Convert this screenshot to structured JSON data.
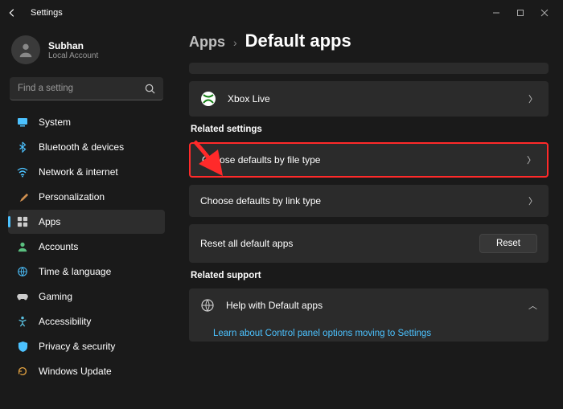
{
  "titlebar": {
    "title": "Settings"
  },
  "user": {
    "name": "Subhan",
    "account_type": "Local Account"
  },
  "search": {
    "placeholder": "Find a setting"
  },
  "sidebar": {
    "items": [
      {
        "label": "System"
      },
      {
        "label": "Bluetooth & devices"
      },
      {
        "label": "Network & internet"
      },
      {
        "label": "Personalization"
      },
      {
        "label": "Apps"
      },
      {
        "label": "Accounts"
      },
      {
        "label": "Time & language"
      },
      {
        "label": "Gaming"
      },
      {
        "label": "Accessibility"
      },
      {
        "label": "Privacy & security"
      },
      {
        "label": "Windows Update"
      }
    ]
  },
  "breadcrumb": {
    "parent": "Apps",
    "current": "Default apps"
  },
  "main": {
    "xbox": {
      "label": "Xbox Live"
    },
    "related_head": "Related settings",
    "file_type": {
      "label": "Choose defaults by file type"
    },
    "link_type": {
      "label": "Choose defaults by link type"
    },
    "reset_all": {
      "label": "Reset all default apps",
      "button": "Reset"
    },
    "support_head": "Related support",
    "help": {
      "label": "Help with Default apps"
    },
    "learn_link": "Learn about Control panel options moving to Settings"
  }
}
